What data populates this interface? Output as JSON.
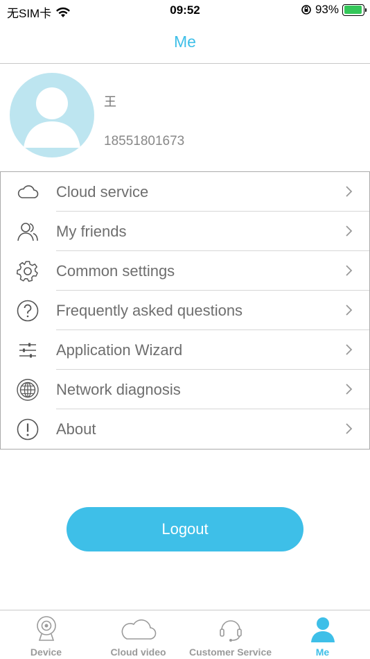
{
  "status_bar": {
    "carrier": "无SIM卡",
    "time": "09:52",
    "battery": "93%",
    "battery_level": 0.93,
    "icons": [
      "wifi-icon",
      "orientation-lock-icon",
      "battery-charging-icon"
    ]
  },
  "nav": {
    "title": "Me"
  },
  "profile": {
    "name": "王",
    "phone": "18551801673",
    "avatar_icon": "user-avatar-icon"
  },
  "menu": {
    "items": [
      {
        "label": "Cloud service",
        "icon": "cloud-icon"
      },
      {
        "label": "My friends",
        "icon": "friends-icon"
      },
      {
        "label": "Common settings",
        "icon": "gear-icon"
      },
      {
        "label": "Frequently asked questions",
        "icon": "question-icon"
      },
      {
        "label": "Application Wizard",
        "icon": "sliders-icon"
      },
      {
        "label": "Network diagnosis",
        "icon": "globe-icon"
      },
      {
        "label": "About",
        "icon": "info-exclamation-icon"
      }
    ]
  },
  "logout_label": "Logout",
  "tab_bar": {
    "tabs": [
      {
        "label": "Device",
        "icon": "camera-icon"
      },
      {
        "label": "Cloud video",
        "icon": "cloud-icon"
      },
      {
        "label": "Customer Service",
        "icon": "headset-icon"
      },
      {
        "label": "Me",
        "icon": "person-icon",
        "active": true
      }
    ]
  },
  "colors": {
    "accent": "#3ebfe8",
    "avatar_bg": "#bde5f0",
    "battery_green": "#34c759"
  }
}
